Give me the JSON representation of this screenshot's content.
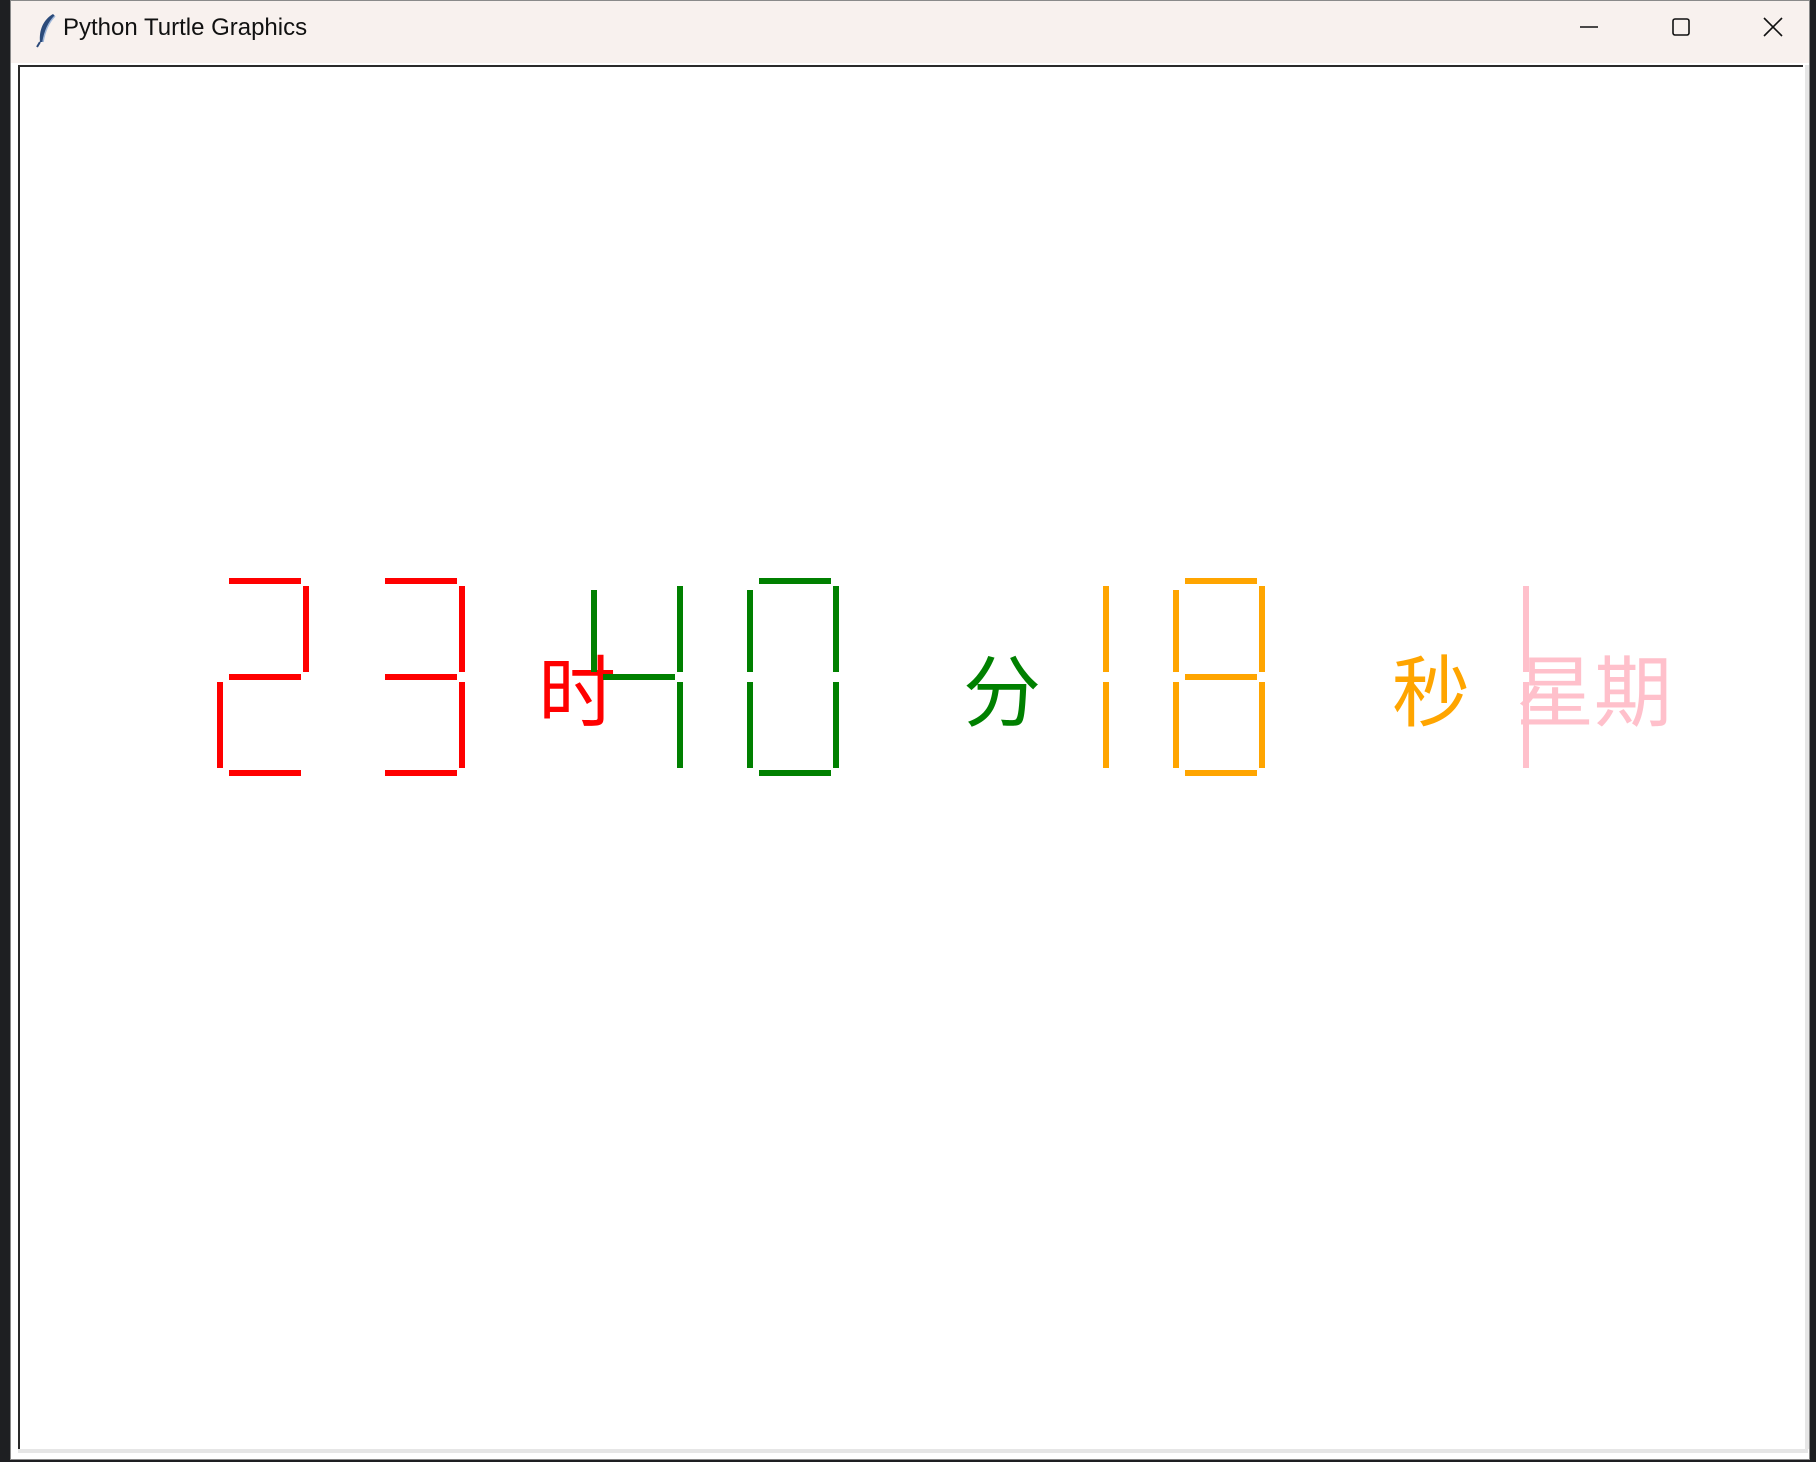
{
  "window": {
    "title": "Python Turtle Graphics",
    "icon": "feather-icon",
    "controls": {
      "minimize": "minimize-icon",
      "maximize": "maximize-icon",
      "close": "close-icon"
    }
  },
  "clock": {
    "hour": "23",
    "minute": "40",
    "second": "18",
    "weekday_digit": "1",
    "hour_label": "时",
    "minute_label": "分",
    "second_label": "秒",
    "weekday_label": "星期",
    "colors": {
      "hour": "#ff0000",
      "minute": "#008000",
      "second": "#ffa500",
      "weekday": "#ffc0cb"
    }
  }
}
